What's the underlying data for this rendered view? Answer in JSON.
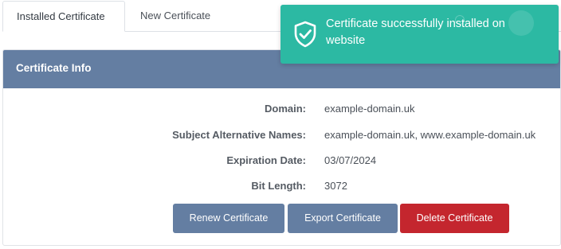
{
  "tabs": [
    {
      "label": "Installed Certificate",
      "active": true
    },
    {
      "label": "New Certificate",
      "active": false
    }
  ],
  "panel": {
    "title": "Certificate Info",
    "rows": [
      {
        "label": "Domain:",
        "value": "example-domain.uk"
      },
      {
        "label": "Subject Alternative Names:",
        "value": "example-domain.uk, www.example-domain.uk"
      },
      {
        "label": "Expiration Date:",
        "value": "03/07/2024"
      },
      {
        "label": "Bit Length:",
        "value": "3072"
      }
    ]
  },
  "buttons": {
    "renew_label": "Renew Certificate",
    "export_label": "Export Certificate",
    "delete_label": "Delete Certificate"
  },
  "toast": {
    "message": "Certificate successfully installed on website",
    "icon": "shield-check-icon",
    "color": "#2cb9a3"
  },
  "colors": {
    "header": "#647ea2",
    "primary_button": "#647ea2",
    "danger_button": "#c4262e"
  }
}
